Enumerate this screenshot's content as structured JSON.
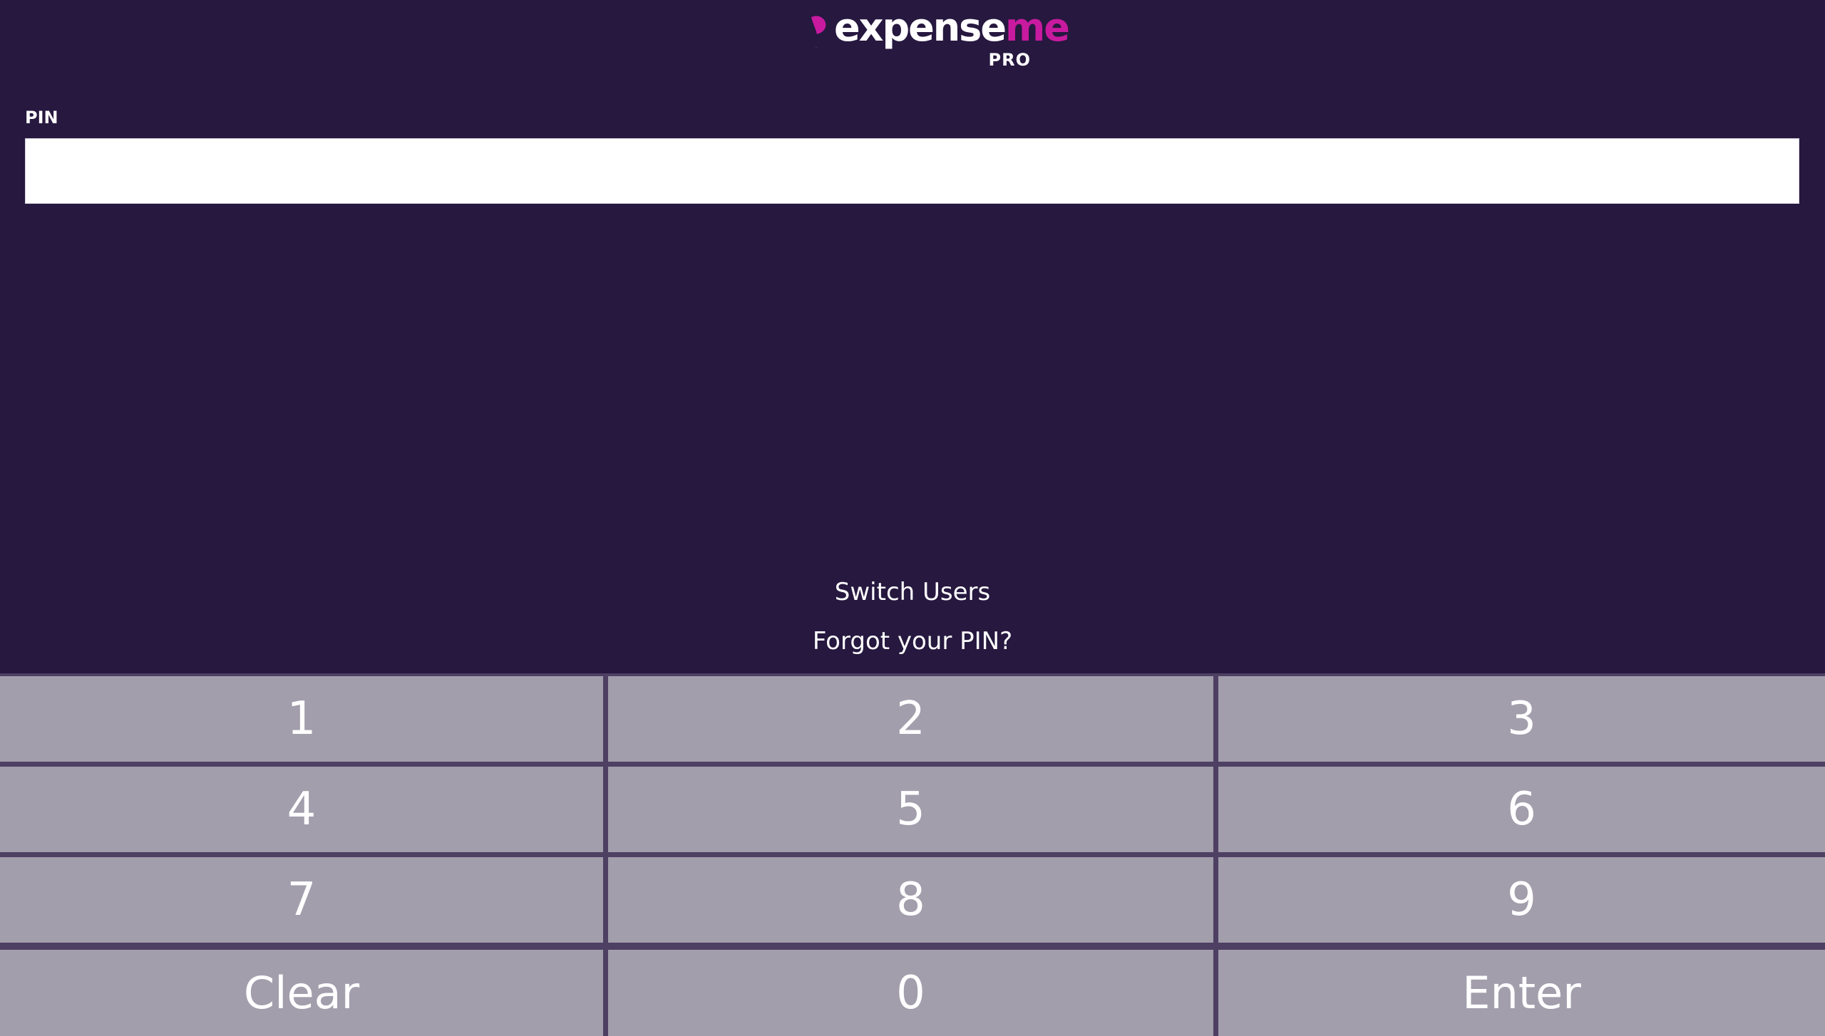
{
  "branding": {
    "word_main": "expense",
    "word_accent": "me",
    "edition": "PRO",
    "accent_color": "#c81a9f",
    "background_color": "#26183f"
  },
  "pin": {
    "label": "PIN",
    "value": ""
  },
  "links": {
    "switch_users": "Switch Users",
    "forgot_pin": "Forgot your PIN?"
  },
  "keypad": {
    "key_color": "#a29eac",
    "keys": [
      "1",
      "2",
      "3",
      "4",
      "5",
      "6",
      "7",
      "8",
      "9",
      "Clear",
      "0",
      "Enter"
    ]
  }
}
